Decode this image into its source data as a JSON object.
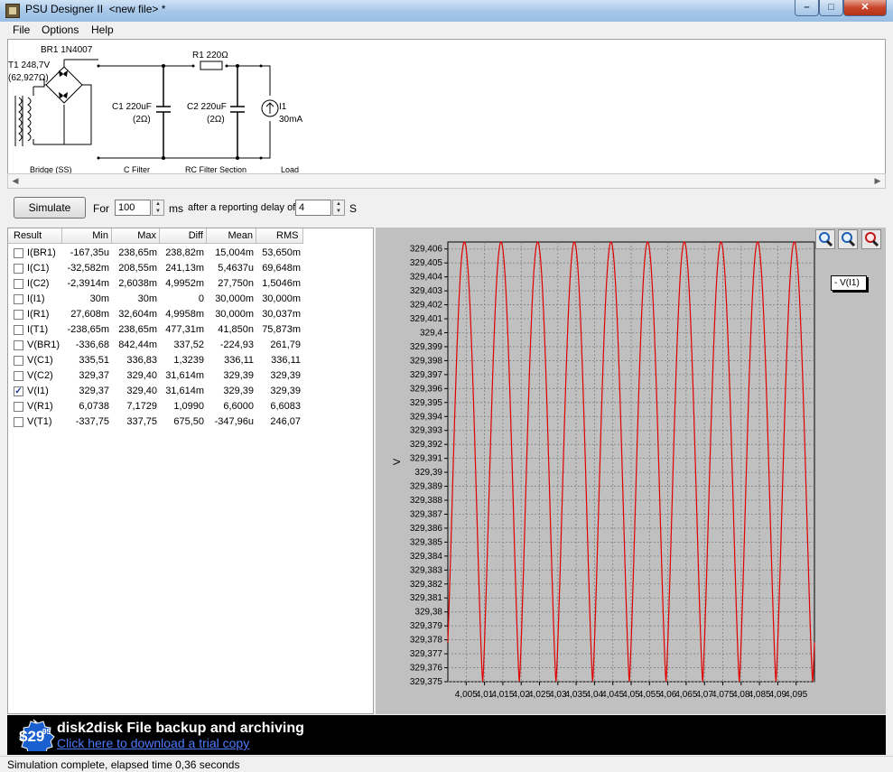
{
  "window": {
    "title": "PSU Designer II  <new file> *",
    "min_glyph": "–",
    "max_glyph": "□",
    "close_glyph": "✕"
  },
  "menu": {
    "items": [
      "File",
      "Options",
      "Help"
    ]
  },
  "schematic": {
    "transformer": {
      "name": "T1 248,7V",
      "sub": "(62,927Ω)"
    },
    "bridge": {
      "name": "BR1 1N4007"
    },
    "c1": {
      "name": "C1 220uF",
      "esr": "(2Ω)"
    },
    "r1": {
      "name": "R1 220Ω"
    },
    "c2": {
      "name": "C2 220uF",
      "esr": "(2Ω)"
    },
    "load": {
      "name": "I1",
      "value": "30mA"
    },
    "sections": [
      "Bridge (SS)",
      "C Filter",
      "RC Filter Section",
      "Load"
    ]
  },
  "toolbar": {
    "simulate_label": "Simulate",
    "for_label": "For",
    "duration_value": "100",
    "ms_label": "ms",
    "delay_label": "after a reporting delay of",
    "delay_value": "4",
    "s_label": "S"
  },
  "results": {
    "columns": [
      "Result",
      "Min",
      "Max",
      "Diff",
      "Mean",
      "RMS"
    ],
    "rows": [
      {
        "name": "I(BR1)",
        "checked": false,
        "min": "-167,35u",
        "max": "238,65m",
        "diff": "238,82m",
        "mean": "15,004m",
        "rms": "53,650m"
      },
      {
        "name": "I(C1)",
        "checked": false,
        "min": "-32,582m",
        "max": "208,55m",
        "diff": "241,13m",
        "mean": "5,4637u",
        "rms": "69,648m"
      },
      {
        "name": "I(C2)",
        "checked": false,
        "min": "-2,3914m",
        "max": "2,6038m",
        "diff": "4,9952m",
        "mean": "27,750n",
        "rms": "1,5046m"
      },
      {
        "name": "I(I1)",
        "checked": false,
        "min": "30m",
        "max": "30m",
        "diff": "0",
        "mean": "30,000m",
        "rms": "30,000m"
      },
      {
        "name": "I(R1)",
        "checked": false,
        "min": "27,608m",
        "max": "32,604m",
        "diff": "4,9958m",
        "mean": "30,000m",
        "rms": "30,037m"
      },
      {
        "name": "I(T1)",
        "checked": false,
        "min": "-238,65m",
        "max": "238,65m",
        "diff": "477,31m",
        "mean": "41,850n",
        "rms": "75,873m"
      },
      {
        "name": "V(BR1)",
        "checked": false,
        "min": "-336,68",
        "max": "842,44m",
        "diff": "337,52",
        "mean": "-224,93",
        "rms": "261,79"
      },
      {
        "name": "V(C1)",
        "checked": false,
        "min": "335,51",
        "max": "336,83",
        "diff": "1,3239",
        "mean": "336,11",
        "rms": "336,11"
      },
      {
        "name": "V(C2)",
        "checked": false,
        "min": "329,37",
        "max": "329,40",
        "diff": "31,614m",
        "mean": "329,39",
        "rms": "329,39"
      },
      {
        "name": "V(I1)",
        "checked": true,
        "min": "329,37",
        "max": "329,40",
        "diff": "31,614m",
        "mean": "329,39",
        "rms": "329,39"
      },
      {
        "name": "V(R1)",
        "checked": false,
        "min": "6,0738",
        "max": "7,1729",
        "diff": "1,0990",
        "mean": "6,6000",
        "rms": "6,6083"
      },
      {
        "name": "V(T1)",
        "checked": false,
        "min": "-337,75",
        "max": "337,75",
        "diff": "675,50",
        "mean": "-347,96u",
        "rms": "246,07"
      }
    ]
  },
  "chart_data": {
    "type": "line",
    "ylabel": "V",
    "xlabel": "",
    "legend": "- V(I1)",
    "legend_position": "top-right",
    "grid": true,
    "ylim": [
      329.375,
      329.4065
    ],
    "xlim": [
      4.0,
      4.1
    ],
    "y_ticks": [
      "329,406",
      "329,405",
      "329,404",
      "329,403",
      "329,402",
      "329,401",
      "329,4",
      "329,399",
      "329,398",
      "329,397",
      "329,396",
      "329,395",
      "329,394",
      "329,393",
      "329,392",
      "329,391",
      "329,39",
      "329,389",
      "329,388",
      "329,387",
      "329,386",
      "329,385",
      "329,384",
      "329,383",
      "329,382",
      "329,381",
      "329,38",
      "329,379",
      "329,378",
      "329,377",
      "329,376",
      "329,375"
    ],
    "x_ticks": [
      "4,005",
      "4,01",
      "4,015",
      "4,02",
      "4,025",
      "4,03",
      "4,035",
      "4,04",
      "4,045",
      "4,05",
      "4,055",
      "4,06",
      "4,065",
      "4,07",
      "4,075",
      "4,08",
      "4,085",
      "4,09",
      "4,095"
    ],
    "series": [
      {
        "name": "V(I1)",
        "color": "#e00000",
        "period_s": 0.01,
        "min": 329.375,
        "max": 329.4065,
        "first_peak_x": 4.0045
      }
    ]
  },
  "zoom": {
    "icons": [
      "zoom-in-icon",
      "zoom-reset-icon",
      "zoom-out-icon"
    ]
  },
  "ad": {
    "price_main": "$29",
    "price_cents": "95",
    "title": "disk2disk File backup and archiving",
    "link": "Click here to download a trial copy"
  },
  "status": {
    "text": "Simulation complete, elapsed time 0,36 seconds"
  }
}
